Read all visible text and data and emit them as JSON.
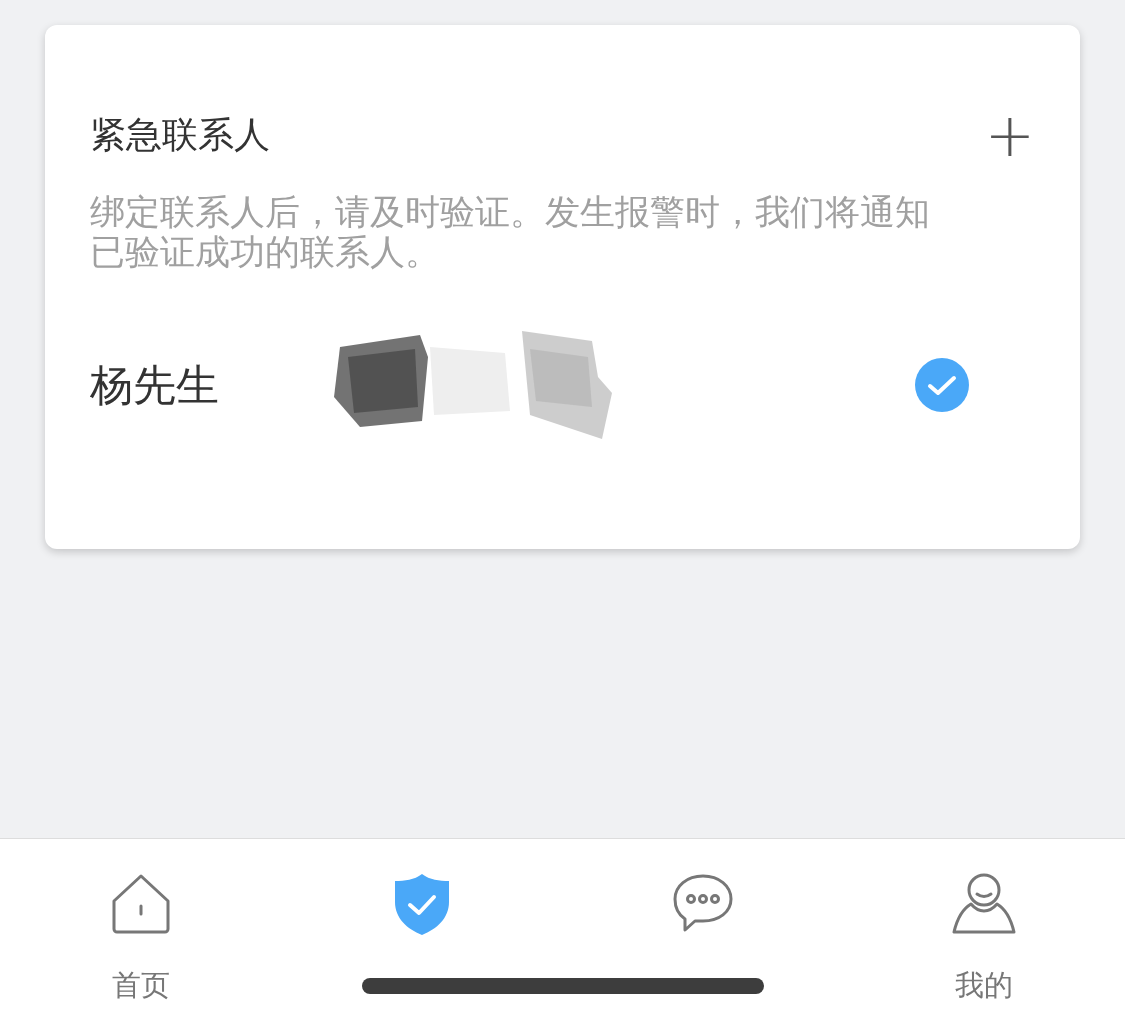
{
  "card": {
    "title": "紧急联系人",
    "add_button": "+",
    "description": "绑定联系人后，请及时验证。发生报警时，我们将通知已验证成功的联系人。",
    "contacts": [
      {
        "name": "杨先生",
        "verified": true
      }
    ]
  },
  "tab_bar": [
    {
      "kind": "home",
      "label": "首页",
      "selected": false
    },
    {
      "kind": "shield",
      "selected": true
    },
    {
      "kind": "chat",
      "selected": false
    },
    {
      "kind": "person",
      "label": "我的",
      "selected": false
    }
  ]
}
